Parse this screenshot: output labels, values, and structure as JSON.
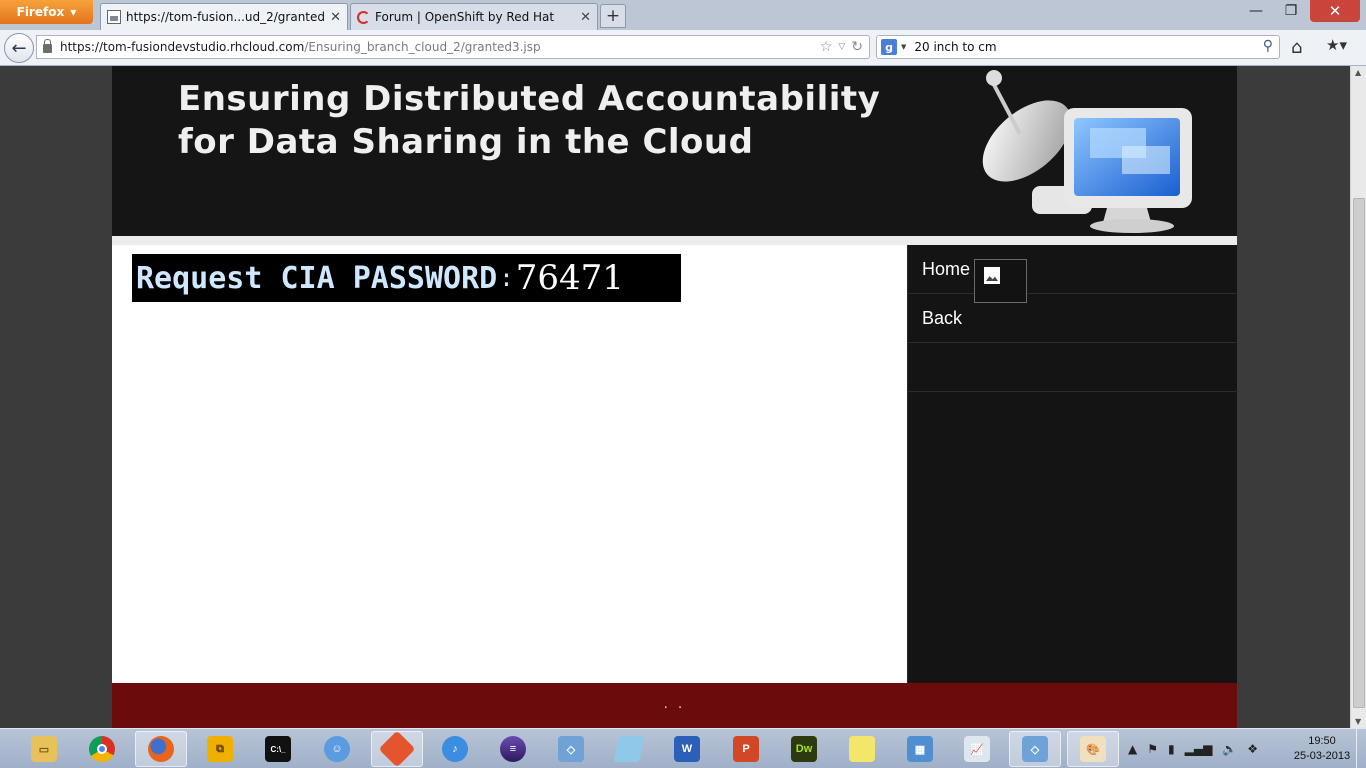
{
  "browser": {
    "menu_button": "Firefox",
    "tabs": [
      {
        "title": "https://tom-fusion...ud_2/granted3.jsp",
        "active": true
      },
      {
        "title": "Forum | OpenShift by Red Hat",
        "active": false
      }
    ],
    "new_tab": "+",
    "url": {
      "host": "https://tom-fusiondevstudio.rhcloud.com",
      "path": "/Ensuring_branch_cloud_2/granted3.jsp"
    },
    "search": {
      "engine": "Google",
      "value": "20 inch to cm"
    },
    "controls": {
      "minimize": "—",
      "maximize": "❐",
      "close": "✕"
    }
  },
  "page": {
    "header": {
      "title_line1": "Ensuring Distributed Accountability",
      "title_line2": "for Data Sharing in the Cloud"
    },
    "content": {
      "password_label": "Request CIA PASSWORD",
      "separator": ":",
      "password_value": "76471"
    },
    "sidebar": {
      "items": [
        {
          "label": "Home"
        },
        {
          "label": "Back"
        },
        {
          "label": ""
        }
      ]
    },
    "footer": {
      "text": ". ."
    }
  },
  "taskbar": {
    "icons": [
      "file-explorer-icon",
      "chrome-icon",
      "firefox-icon",
      "vmware-icon",
      "cmd-icon",
      "finder-icon",
      "git-icon",
      "itunes-icon",
      "eclipse-icon",
      "virtualbox-icon",
      "notepad-icon",
      "word-icon",
      "powerpoint-icon",
      "dreamweaver-icon",
      "sticky-notes-icon",
      "control-panel-icon",
      "task-monitor-icon",
      "virtualbox-2-icon",
      "paint-icon"
    ],
    "active_icon": "firefox-icon",
    "clock": {
      "time": "19:50",
      "date": "25-03-2013"
    }
  },
  "colors": {
    "header_bg": "#151515",
    "sidebar_bg": "#141414",
    "footer_bg": "#6b0b0b",
    "password_box_bg": "#000000"
  }
}
